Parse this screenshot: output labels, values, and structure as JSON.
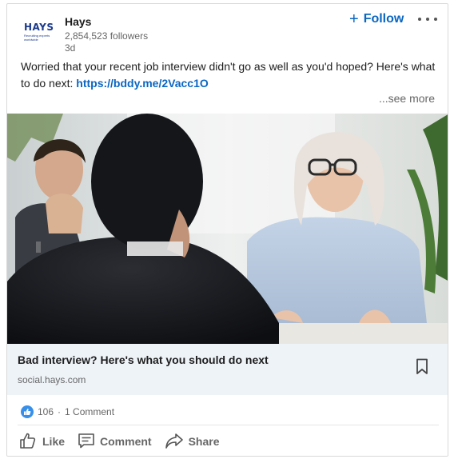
{
  "post": {
    "company_name": "Hays",
    "logo": {
      "word": "HAYS",
      "tagline": "Recruiting experts worldwide",
      "color": "#1b3a8c"
    },
    "followers": "2,854,523 followers",
    "time_ago": "3d",
    "follow_label": "Follow",
    "follow_icon": "plus-icon",
    "more_icon": "ellipsis-icon",
    "commentary_text": "Worried that your recent job interview didn't go as well as you'd hoped? Here's what to do next: ",
    "commentary_link": "https://bddy.me/2Vacc1O",
    "see_more": "...see more"
  },
  "article": {
    "title": "Bad interview? Here's what you should do next",
    "source": "social.hays.com",
    "bookmark_icon": "bookmark-icon"
  },
  "social": {
    "reaction_icon": "like-icon",
    "reactions": "106",
    "separator": "·",
    "comments": "1 Comment"
  },
  "actions": [
    {
      "label": "Like",
      "icon": "thumbs-up-icon"
    },
    {
      "label": "Comment",
      "icon": "comment-icon"
    },
    {
      "label": "Share",
      "icon": "share-icon"
    }
  ],
  "colors": {
    "accent": "#0a66c2",
    "article_bg": "#eef3f8",
    "secondary_text": "#666666",
    "like_badge": "#378fe9"
  }
}
